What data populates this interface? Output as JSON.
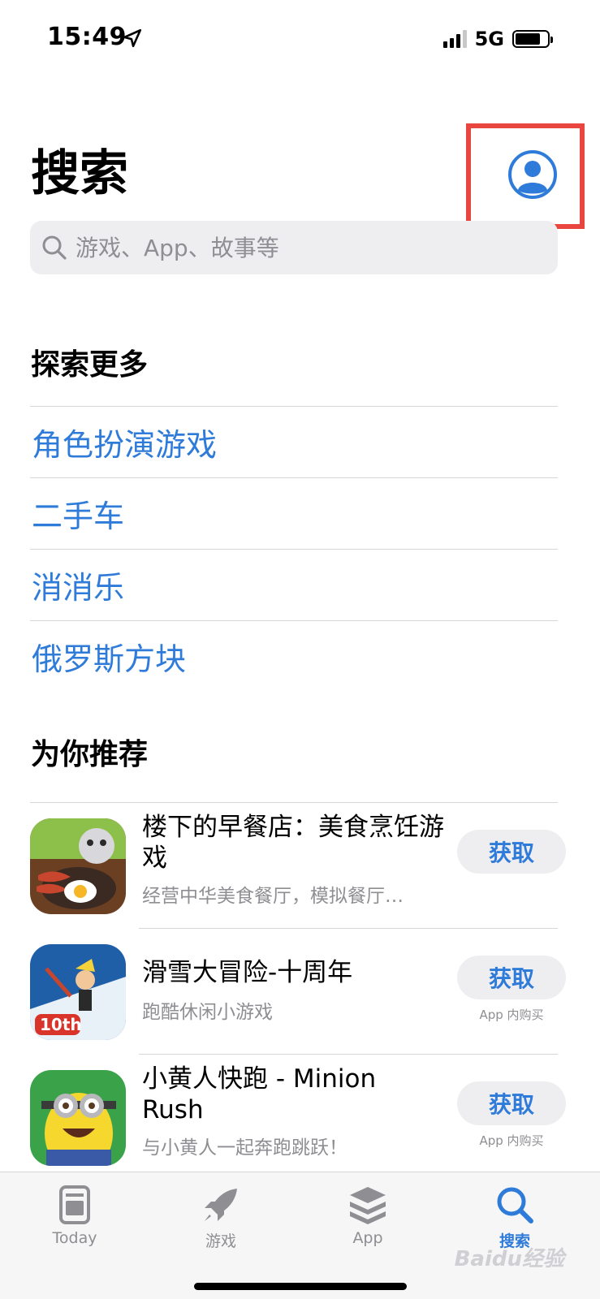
{
  "status_bar": {
    "time": "15:49",
    "network": "5G"
  },
  "header": {
    "title": "搜索"
  },
  "search": {
    "placeholder": "游戏、App、故事等"
  },
  "explore": {
    "title": "探索更多",
    "items": [
      {
        "label": "角色扮演游戏"
      },
      {
        "label": "二手车"
      },
      {
        "label": "消消乐"
      },
      {
        "label": "俄罗斯方块"
      }
    ]
  },
  "recommend": {
    "title": "为你推荐",
    "apps": [
      {
        "name": "楼下的早餐店：美食烹饪游戏",
        "subtitle": "经营中华美食餐厅，模拟餐厅…",
        "button": "获取",
        "iap": ""
      },
      {
        "name": "滑雪大冒险-十周年",
        "subtitle": "跑酷休闲小游戏",
        "button": "获取",
        "iap": "App 内购买"
      },
      {
        "name": "小黄人快跑 - Minion Rush",
        "subtitle": "与小黄人一起奔跑跳跃！",
        "button": "获取",
        "iap": "App 内购买"
      }
    ]
  },
  "tabs": [
    {
      "label": "Today",
      "icon": "today-icon",
      "active": false
    },
    {
      "label": "游戏",
      "icon": "rocket-icon",
      "active": false
    },
    {
      "label": "App",
      "icon": "apps-stack-icon",
      "active": false
    },
    {
      "label": "搜索",
      "icon": "search-icon",
      "active": true
    }
  ],
  "watermark": "Baidu经验",
  "colors": {
    "accent": "#2e7bd9",
    "highlight": "#e8463e",
    "secondary_text": "#8e8e93"
  }
}
